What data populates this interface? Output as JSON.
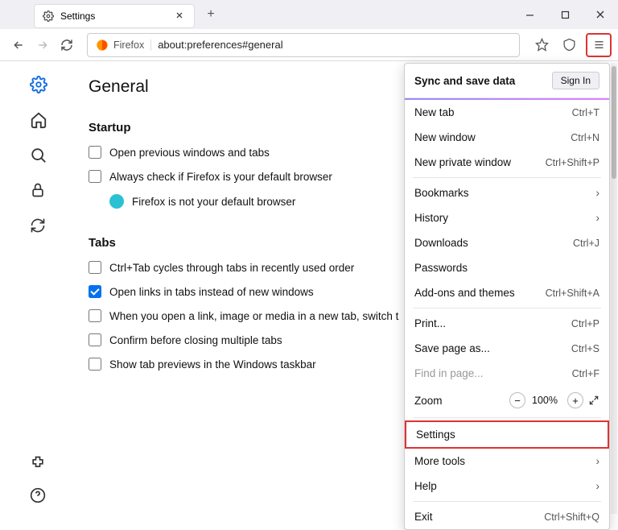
{
  "tab": {
    "title": "Settings"
  },
  "urlbar": {
    "label": "Firefox",
    "url": "about:preferences#general"
  },
  "page": {
    "heading": "General",
    "startup": {
      "title": "Startup",
      "open_previous": "Open previous windows and tabs",
      "check_default": "Always check if Firefox is your default browser",
      "status": "Firefox is not your default browser"
    },
    "tabs": {
      "title": "Tabs",
      "ctrl_tab": "Ctrl+Tab cycles through tabs in recently used order",
      "open_links": "Open links in tabs instead of new windows",
      "switch_new": "When you open a link, image or media in a new tab, switch t",
      "confirm_close": "Confirm before closing multiple tabs",
      "taskbar_previews": "Show tab previews in the Windows taskbar"
    }
  },
  "menu": {
    "sync_title": "Sync and save data",
    "sign_in": "Sign In",
    "new_tab": {
      "label": "New tab",
      "shortcut": "Ctrl+T"
    },
    "new_window": {
      "label": "New window",
      "shortcut": "Ctrl+N"
    },
    "new_private": {
      "label": "New private window",
      "shortcut": "Ctrl+Shift+P"
    },
    "bookmarks": {
      "label": "Bookmarks"
    },
    "history": {
      "label": "History"
    },
    "downloads": {
      "label": "Downloads",
      "shortcut": "Ctrl+J"
    },
    "passwords": {
      "label": "Passwords"
    },
    "addons": {
      "label": "Add-ons and themes",
      "shortcut": "Ctrl+Shift+A"
    },
    "print": {
      "label": "Print...",
      "shortcut": "Ctrl+P"
    },
    "save_page": {
      "label": "Save page as...",
      "shortcut": "Ctrl+S"
    },
    "find": {
      "label": "Find in page...",
      "shortcut": "Ctrl+F"
    },
    "zoom": {
      "label": "Zoom",
      "value": "100%"
    },
    "settings": {
      "label": "Settings"
    },
    "more_tools": {
      "label": "More tools"
    },
    "help": {
      "label": "Help"
    },
    "exit": {
      "label": "Exit",
      "shortcut": "Ctrl+Shift+Q"
    }
  }
}
